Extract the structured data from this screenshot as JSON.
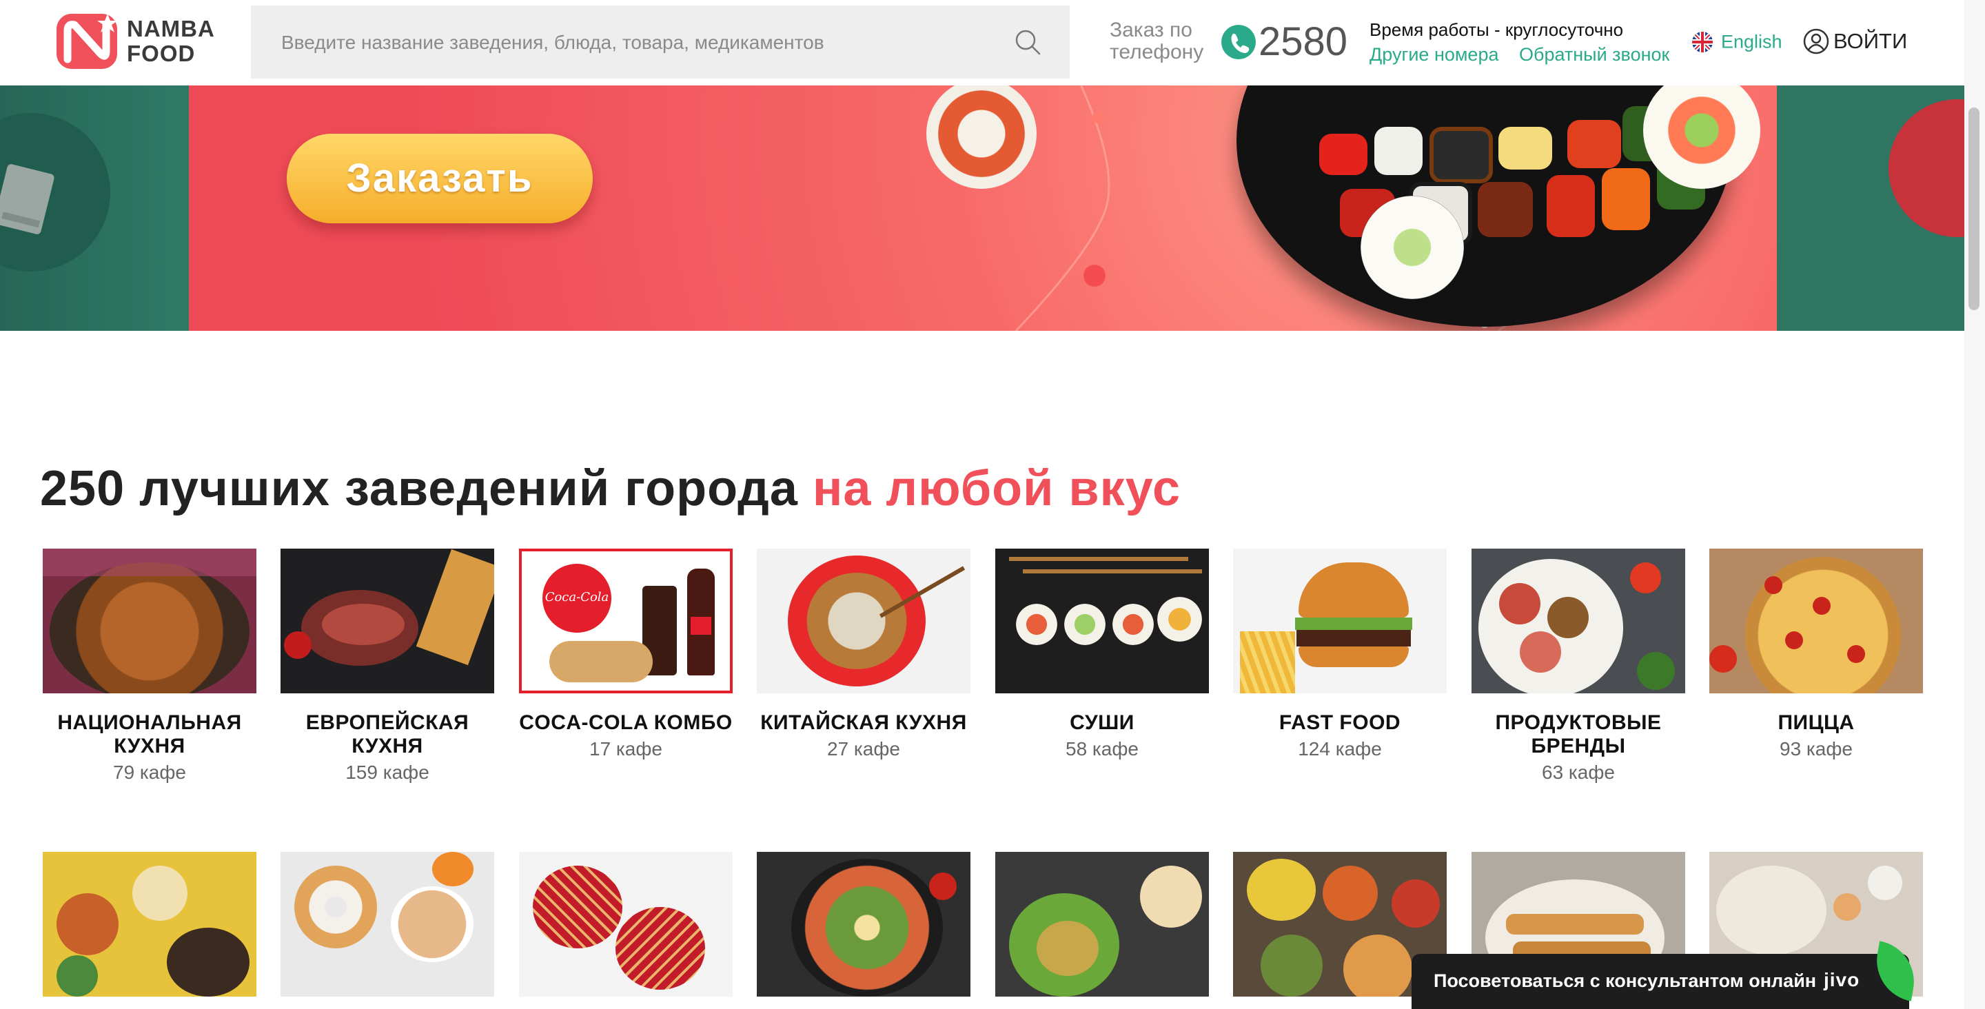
{
  "header": {
    "logo": {
      "line1": "NAMBA",
      "line2": "FOOD",
      "icon": "namba-food-logo-icon"
    },
    "search": {
      "placeholder": "Введите название заведения, блюда, товара, медикаментов",
      "icon": "search-icon"
    },
    "phone": {
      "caption_line1": "Заказ по",
      "caption_line2": "телефону",
      "number": "2580",
      "icon": "phone-icon"
    },
    "work_hours": "Время работы - круглосуточно",
    "other_numbers": "Другие номера",
    "callback": "Обратный звонок",
    "language": {
      "label": "English",
      "icon": "uk-flag-icon"
    },
    "login": {
      "label": "ВОЙТИ",
      "icon": "user-icon"
    }
  },
  "banner": {
    "button_label": "Заказать",
    "slides_total": 2,
    "active_slide": 2
  },
  "section": {
    "title_main": "250 лучших заведений города",
    "title_accent": "на любой вкус"
  },
  "categories_row1": [
    {
      "name": "НАЦИОНАЛЬНАЯ КУХНЯ",
      "count": "79 кафе"
    },
    {
      "name": "ЕВРОПЕЙСКАЯ КУХНЯ",
      "count": "159 кафе"
    },
    {
      "name": "COCA-COLA КОМБО",
      "count": "17 кафе",
      "image_text": "Coca-Cola"
    },
    {
      "name": "КИТАЙСКАЯ КУХНЯ",
      "count": "27 кафе"
    },
    {
      "name": "СУШИ",
      "count": "58 кафе"
    },
    {
      "name": "FAST FOOD",
      "count": "124 кафе"
    },
    {
      "name": "ПРОДУКТОВЫЕ БРЕНДЫ",
      "count": "63 кафе"
    },
    {
      "name": "ПИЦЦА",
      "count": "93 кафе"
    }
  ],
  "jivo": {
    "label": "Посоветоваться с консультантом онлайн",
    "brand": "jivo"
  },
  "colors": {
    "brand_red": "#f0505a",
    "accent_teal": "#2aaa8a",
    "banner_green": "#2d7360",
    "button_yellow": "#f6ae2b"
  }
}
